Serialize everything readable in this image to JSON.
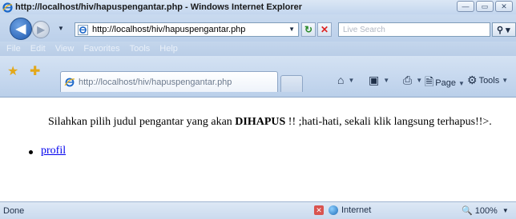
{
  "window": {
    "title": "http://localhost/hiv/hapuspengantar.php - Windows Internet Explorer",
    "minimize_glyph": "—",
    "maximize_glyph": "▭",
    "close_glyph": "✕"
  },
  "address_bar": {
    "url": "http://localhost/hiv/hapuspengantar.php",
    "refresh_glyph": "↻",
    "stop_glyph": "✕"
  },
  "search": {
    "placeholder": "Live Search",
    "button_glyph": "⚲"
  },
  "menu": {
    "items": [
      "File",
      "Edit",
      "View",
      "Favorites",
      "Tools",
      "Help"
    ]
  },
  "tab": {
    "label": "http://localhost/hiv/hapuspengantar.php"
  },
  "command_bar": {
    "home_glyph": "⌂",
    "feeds_glyph": "▣",
    "print_glyph": "⎙",
    "page_label": "Page",
    "tools_label": "Tools"
  },
  "content": {
    "message_pre": "Silahkan pilih judul pengantar yang akan ",
    "message_bold": "DIHAPUS",
    "message_post": " !! ;hati-hati, sekali klik langsung terhapus!!>.",
    "links": [
      "profil"
    ]
  },
  "status": {
    "text": "Done",
    "zone_label": "Internet",
    "zoom": "100%"
  },
  "colors": {
    "chrome": "#c5d7ee",
    "link": "#0000ee"
  }
}
